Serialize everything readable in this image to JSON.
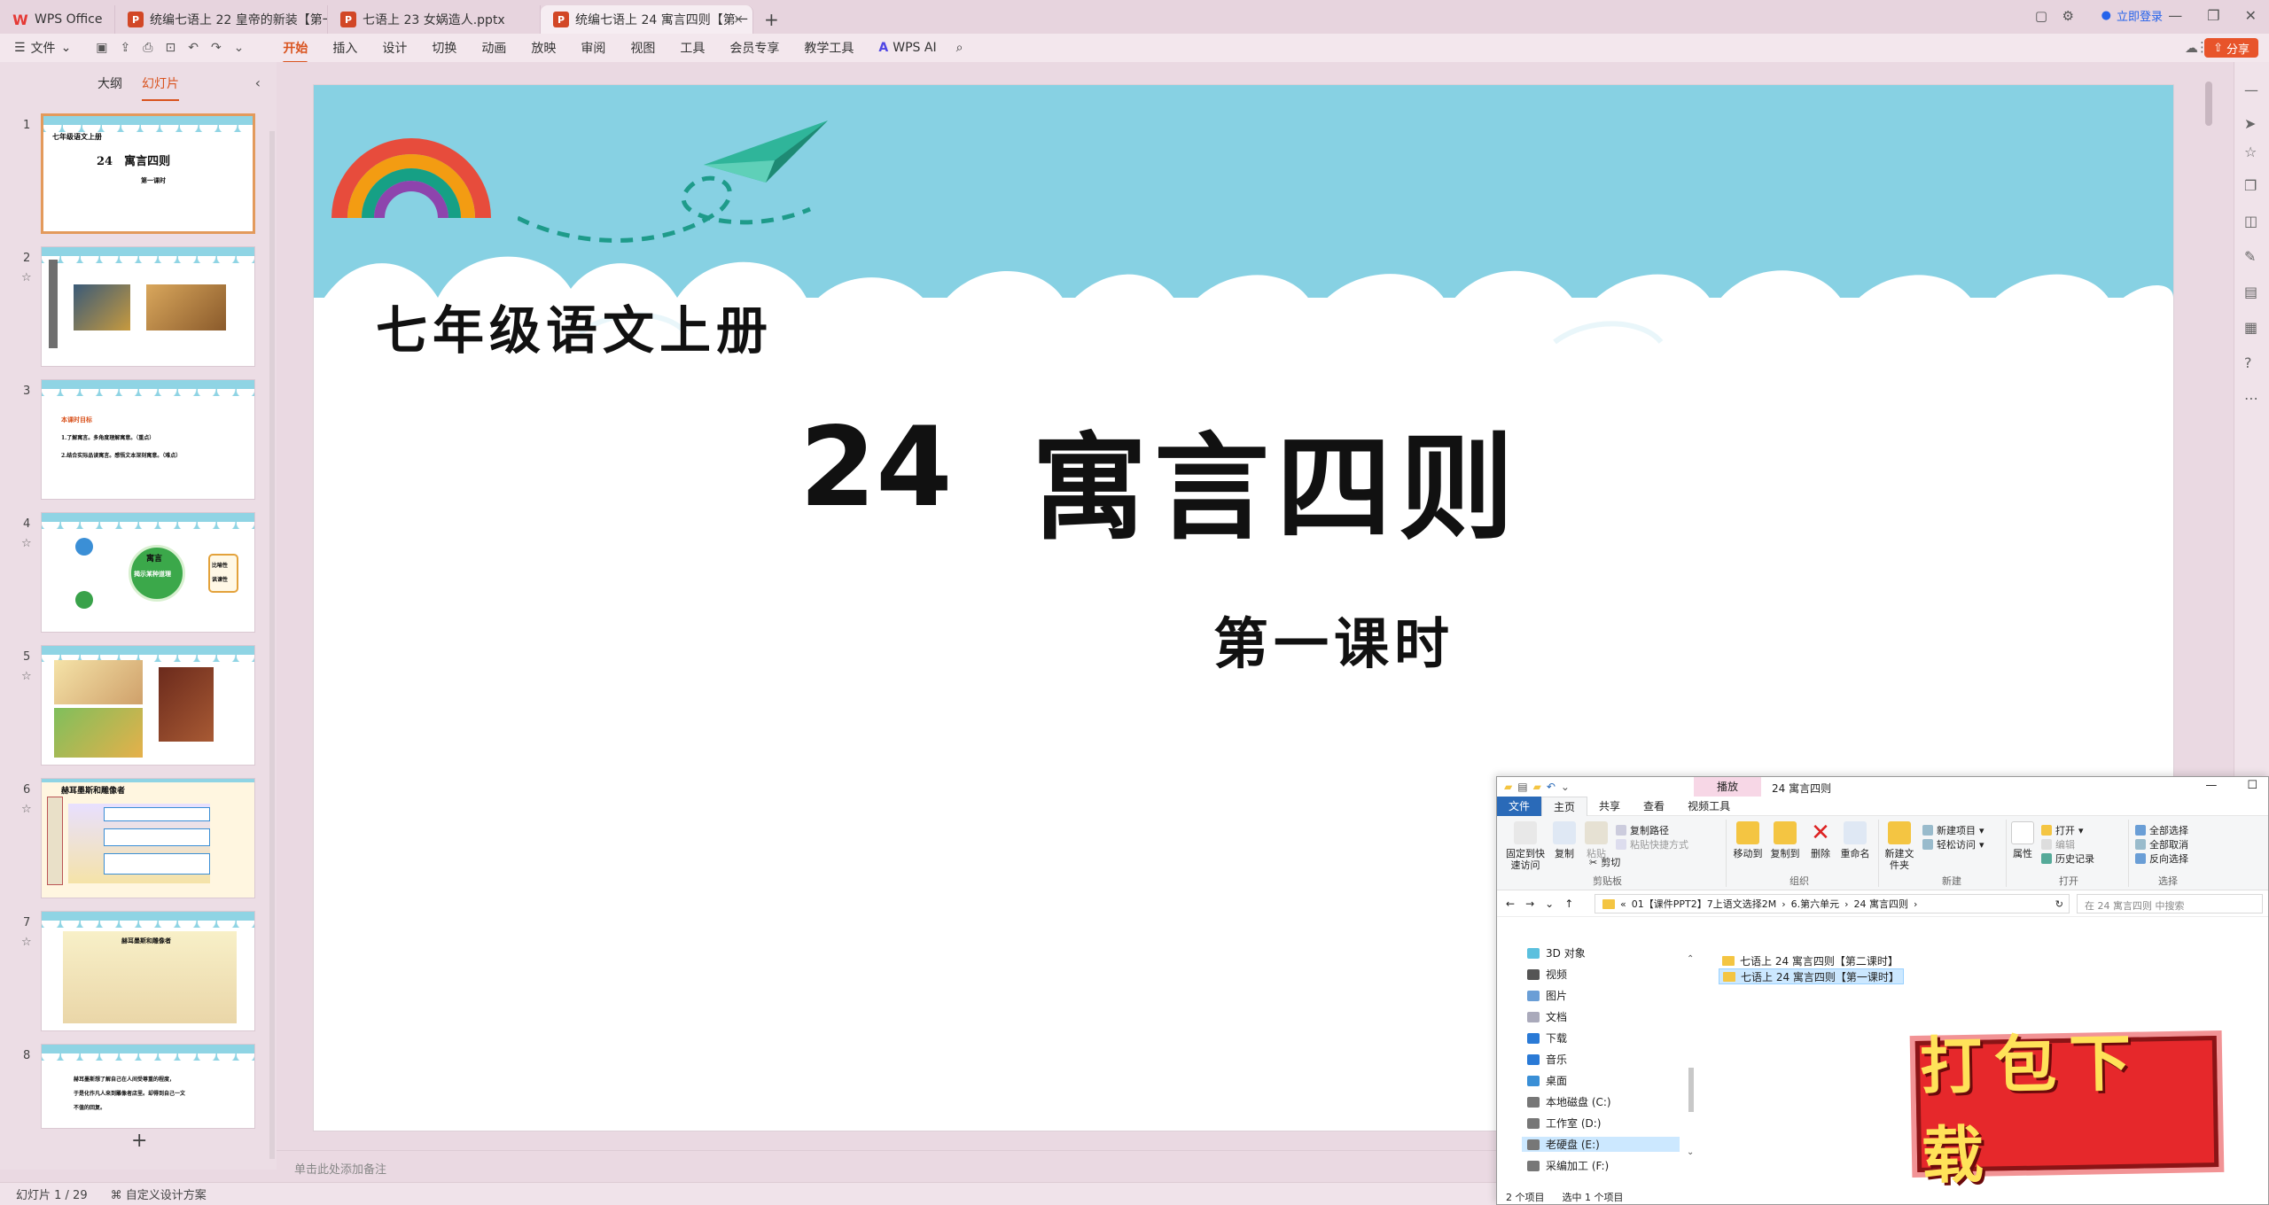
{
  "tabs": {
    "home": "WPS Office",
    "tab1": "统编七语上 22 皇帝的新装【第一课",
    "tab2": "七语上 23 女娲造人.pptx",
    "tab3": "统编七语上 24 寓言四则【第一"
  },
  "titlebar": {
    "login": "立即登录"
  },
  "menu": {
    "file": "文件",
    "items": [
      "开始",
      "插入",
      "设计",
      "切换",
      "动画",
      "放映",
      "审阅",
      "视图",
      "工具",
      "会员专享",
      "教学工具"
    ],
    "ai": "WPS AI",
    "share": "分享"
  },
  "panel": {
    "tab_outline": "大纲",
    "tab_slides": "幻灯片",
    "thumb1": {
      "line1": "七年级语文上册",
      "line2": "24　寓言四则",
      "line3": "第一课时"
    },
    "thumb3": {
      "line1": "本课时目标",
      "line2": "1.了解寓言。多角度理解寓意。（重点）",
      "line3": "2.结合实际品读寓言。感悟文本深刻寓意。（难点）"
    },
    "thumb4": {
      "center": "寓言",
      "sub": "揭示某种道理",
      "right1": "比喻性",
      "right2": "讽谏性"
    },
    "thumb6": {
      "title": "赫耳墨斯和雕像者"
    },
    "thumb7": {
      "title": "赫耳墨斯和雕像者"
    },
    "thumb8": {
      "line1": "赫耳墨斯想了解自己在人间受尊重的程度，",
      "line2": "于是化作凡人来到雕像者店里。却得到自己一文",
      "line3": "不值的回复。"
    }
  },
  "slide": {
    "subtitle": "七年级语文上册",
    "number": "24",
    "title": "寓言四则",
    "period": "第一课时"
  },
  "notes": "单击此处添加备注",
  "status": {
    "slide_count": "幻灯片 1 / 29",
    "design": "自定义设计方案"
  },
  "explorer": {
    "manage": "播放",
    "title": "24 寓言四则",
    "tabs": [
      "文件",
      "主页",
      "共享",
      "查看",
      "视频工具"
    ],
    "ribbon": {
      "pin": "固定到快速访问",
      "copy": "复制",
      "paste": "粘贴",
      "copy_path": "复制路径",
      "paste_shortcut": "粘贴快捷方式",
      "cut": "剪切",
      "clipboard": "剪贴板",
      "move_to": "移动到",
      "copy_to": "复制到",
      "delete": "删除",
      "rename": "重命名",
      "organize": "组织",
      "new_folder": "新建文件夹",
      "new_item": "新建项目",
      "easy_access": "轻松访问",
      "new": "新建",
      "properties": "属性",
      "open": "打开",
      "edit": "编辑",
      "history": "历史记录",
      "open_group": "打开",
      "select_all": "全部选择",
      "select_none": "全部取消",
      "invert": "反向选择",
      "select": "选择"
    },
    "path": [
      "01【课件PPT2】7上语文选择2M",
      "6.第六单元",
      "24 寓言四则"
    ],
    "search_placeholder": "在 24 寓言四则 中搜索",
    "nav": [
      "3D 对象",
      "视频",
      "图片",
      "文档",
      "下载",
      "音乐",
      "桌面",
      "本地磁盘 (C:)",
      "工作室 (D:)",
      "老硬盘 (E:)",
      "采编加工 (F:)"
    ],
    "files": [
      "七语上 24 寓言四则【第二课时】",
      "七语上 24 寓言四则【第一课时】"
    ],
    "status_items": "2 个项目",
    "status_selected": "选中 1 个项目"
  },
  "stamp": "打包下载",
  "colors": {
    "accent": "#d9531e",
    "sky": "#87d1e3",
    "stamp": "#e6282b"
  }
}
